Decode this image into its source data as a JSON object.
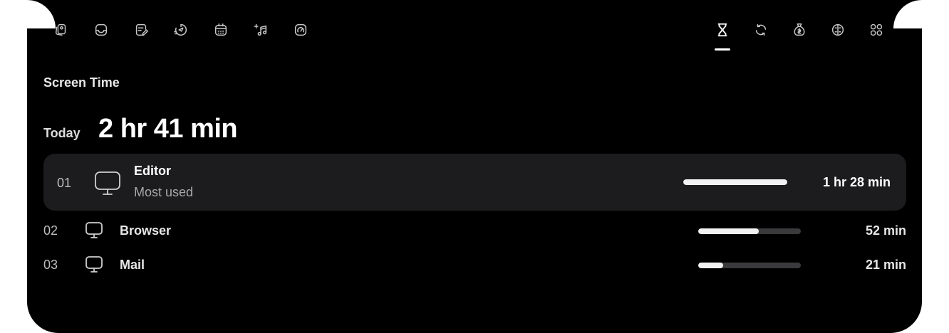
{
  "toolbar": {
    "left_icons": [
      "cards-icon",
      "inbox-icon",
      "notes-icon",
      "timer-icon",
      "calendar-icon",
      "music-icon",
      "gauge-icon"
    ],
    "right_icons": [
      "hourglass-icon",
      "sync-icon",
      "money-bag-icon",
      "brain-icon",
      "grid-icon"
    ],
    "active_icon": "hourglass-icon"
  },
  "screen_time": {
    "title": "Screen Time",
    "today_label": "Today",
    "total": "2 hr 41 min",
    "apps": [
      {
        "rank": "01",
        "name": "Editor",
        "subtitle": "Most used",
        "time": "1 hr 28 min",
        "usage_fraction": 1.0
      },
      {
        "rank": "02",
        "name": "Browser",
        "time": "52 min",
        "usage_fraction": 0.59
      },
      {
        "rank": "03",
        "name": "Mail",
        "time": "21 min",
        "usage_fraction": 0.24
      }
    ]
  },
  "colors": {
    "background": "#000000",
    "highlight_row": "#1c1c1e",
    "bar_track": "#3a3a3c",
    "bar_fill": "#f2f2f2"
  }
}
